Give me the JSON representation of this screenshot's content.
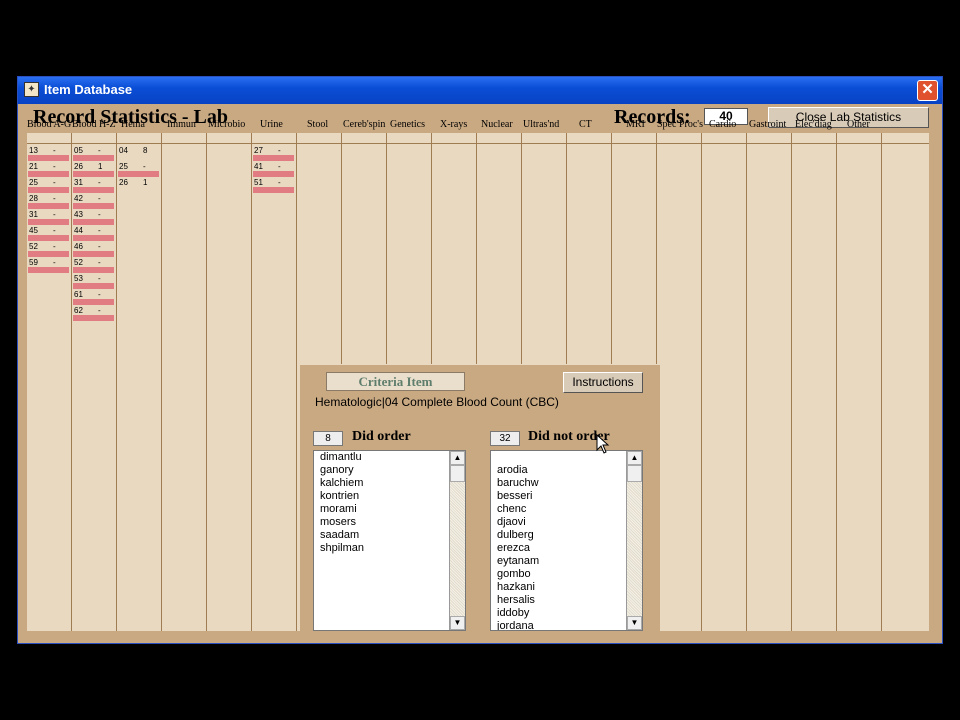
{
  "window": {
    "title": "Item Database",
    "close_glyph": "✕",
    "icon": "app-icon"
  },
  "header": {
    "title": "Record Statistics - Lab",
    "records_label": "Records:",
    "records_value": "40",
    "close_button": "Close Lab Statistics"
  },
  "columns": [
    "Blood A-G",
    "Blood H-Z",
    "Hema",
    "Immun",
    "Microbio",
    "Urine",
    "Stool",
    "Cereb'spin",
    "Genetics",
    "X-rays",
    "Nuclear",
    "Ultras'nd",
    "CT",
    "MRI",
    "Spec Proc's",
    "Cardio",
    "Gastroint",
    "Elec'diag",
    "Other"
  ],
  "entries": {
    "blood_ag": [
      {
        "id": "13",
        "val": "-"
      },
      {
        "id": "21",
        "val": "-"
      },
      {
        "id": "25",
        "val": "-"
      },
      {
        "id": "28",
        "val": "-"
      },
      {
        "id": "31",
        "val": "-"
      },
      {
        "id": "45",
        "val": "-"
      },
      {
        "id": "52",
        "val": "-"
      },
      {
        "id": "59",
        "val": "-"
      }
    ],
    "blood_hz": [
      {
        "id": "05",
        "val": "-"
      },
      {
        "id": "26",
        "val": "1"
      },
      {
        "id": "31",
        "val": "-"
      },
      {
        "id": "42",
        "val": "-"
      },
      {
        "id": "43",
        "val": "-"
      },
      {
        "id": "44",
        "val": "-"
      },
      {
        "id": "46",
        "val": "-"
      },
      {
        "id": "52",
        "val": "-"
      },
      {
        "id": "53",
        "val": "-"
      },
      {
        "id": "61",
        "val": "-"
      },
      {
        "id": "62",
        "val": "-"
      }
    ],
    "hema": [
      {
        "id": "04",
        "val": "8"
      },
      {
        "id": "25",
        "val": "-"
      },
      {
        "id": "26",
        "val": "1"
      }
    ],
    "urine": [
      {
        "id": "27",
        "val": "-"
      },
      {
        "id": "41",
        "val": "-"
      },
      {
        "id": "51",
        "val": "-"
      }
    ]
  },
  "criteria": {
    "title": "Criteria Item",
    "instructions_button": "Instructions",
    "item_text": "Hematologic|04 Complete Blood Count (CBC)",
    "did_order": {
      "count": "8",
      "label": "Did order",
      "names": [
        "dimantlu",
        "ganory",
        "kalchiem",
        "kontrien",
        "morami",
        "mosers",
        "saadam",
        "shpilman"
      ]
    },
    "did_not_order": {
      "count": "32",
      "label": "Did not order",
      "names": [
        "",
        "arodia",
        "baruchw",
        "besseri",
        "chenc",
        "djaovi",
        "dulberg",
        "erezca",
        "eytanam",
        "gombo",
        "hazkani",
        "hersalis",
        "iddoby",
        "jordana"
      ]
    }
  },
  "scroll": {
    "up": "▲",
    "down": "▼"
  },
  "colors": {
    "titlebar": "#0a4ed6",
    "panel": "#c9a982",
    "grid": "#e9d9c1",
    "bar": "#e07c82",
    "criteria_title": "#5f7d6d"
  }
}
